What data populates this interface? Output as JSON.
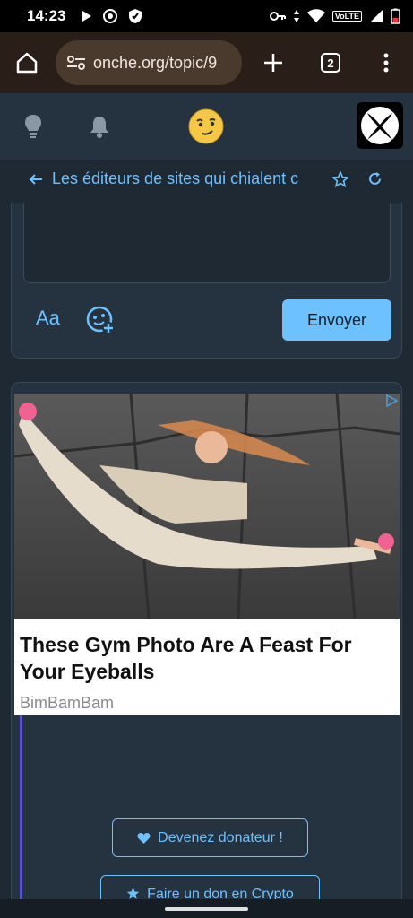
{
  "status_bar": {
    "time": "14:23",
    "network_badge": "VoLTE"
  },
  "browser": {
    "url": "onche.org/topic/9",
    "tab_count": "2"
  },
  "topic": {
    "title": "Les éditeurs de sites qui chialent c"
  },
  "reply": {
    "font_button": "Aa",
    "send_label": "Envoyer"
  },
  "ad": {
    "headline": "These Gym Photo Are A Feast For Your Eyeballs",
    "source": "BimBamBam"
  },
  "donation": {
    "donate_label": "Devenez donateur !",
    "crypto_label": "Faire un don en Crypto"
  },
  "colors": {
    "accent": "#6ec1ff",
    "nav_bg": "#253240",
    "page_bg": "#1f2933",
    "browser_bg": "#2a1f18"
  }
}
